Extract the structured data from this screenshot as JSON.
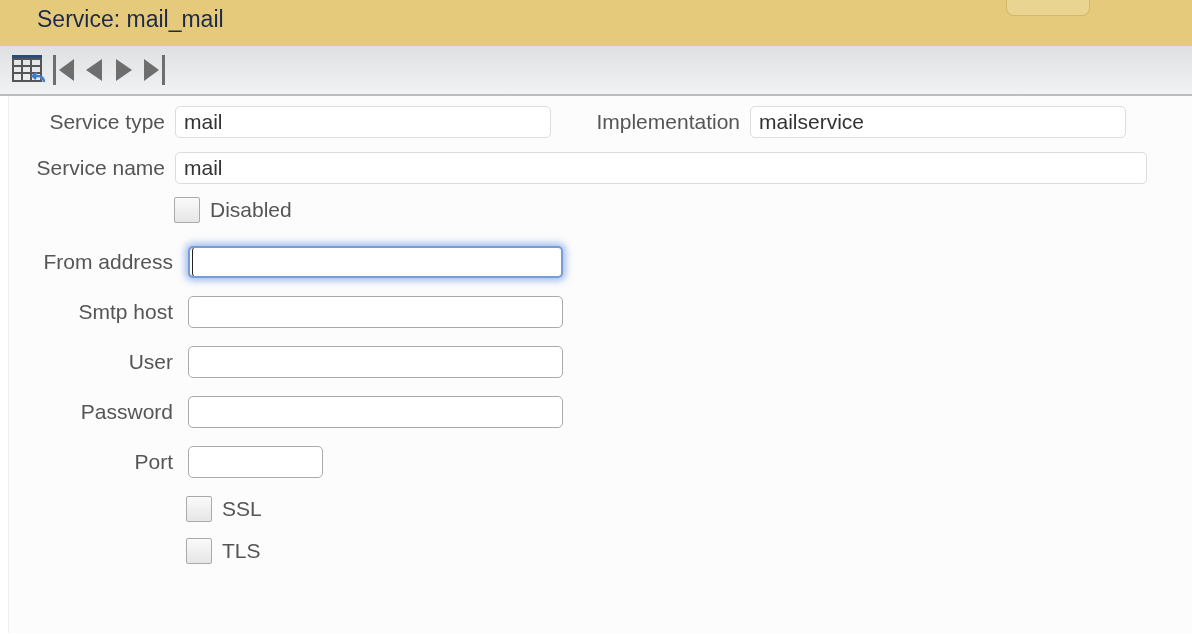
{
  "header": {
    "title": "Service: mail_mail"
  },
  "service_fields": [
    {
      "label": "Service type",
      "value": "mail"
    },
    {
      "label": "Implementation",
      "value": "mailservice"
    },
    {
      "label": "Service name",
      "value": "mail"
    }
  ],
  "disabled_option": {
    "label": "Disabled",
    "checked": false
  },
  "mail_fields": [
    {
      "label": "From address",
      "focused": true,
      "kind": "wide"
    },
    {
      "label": "Smtp host",
      "focused": false,
      "kind": "wide"
    },
    {
      "label": "User",
      "focused": false,
      "kind": "wide"
    },
    {
      "label": "Password",
      "focused": false,
      "kind": "wide"
    },
    {
      "label": "Port",
      "focused": false,
      "kind": "short"
    }
  ],
  "security_options": [
    {
      "label": "SSL",
      "checked": false
    },
    {
      "label": "TLS",
      "checked": false
    }
  ]
}
